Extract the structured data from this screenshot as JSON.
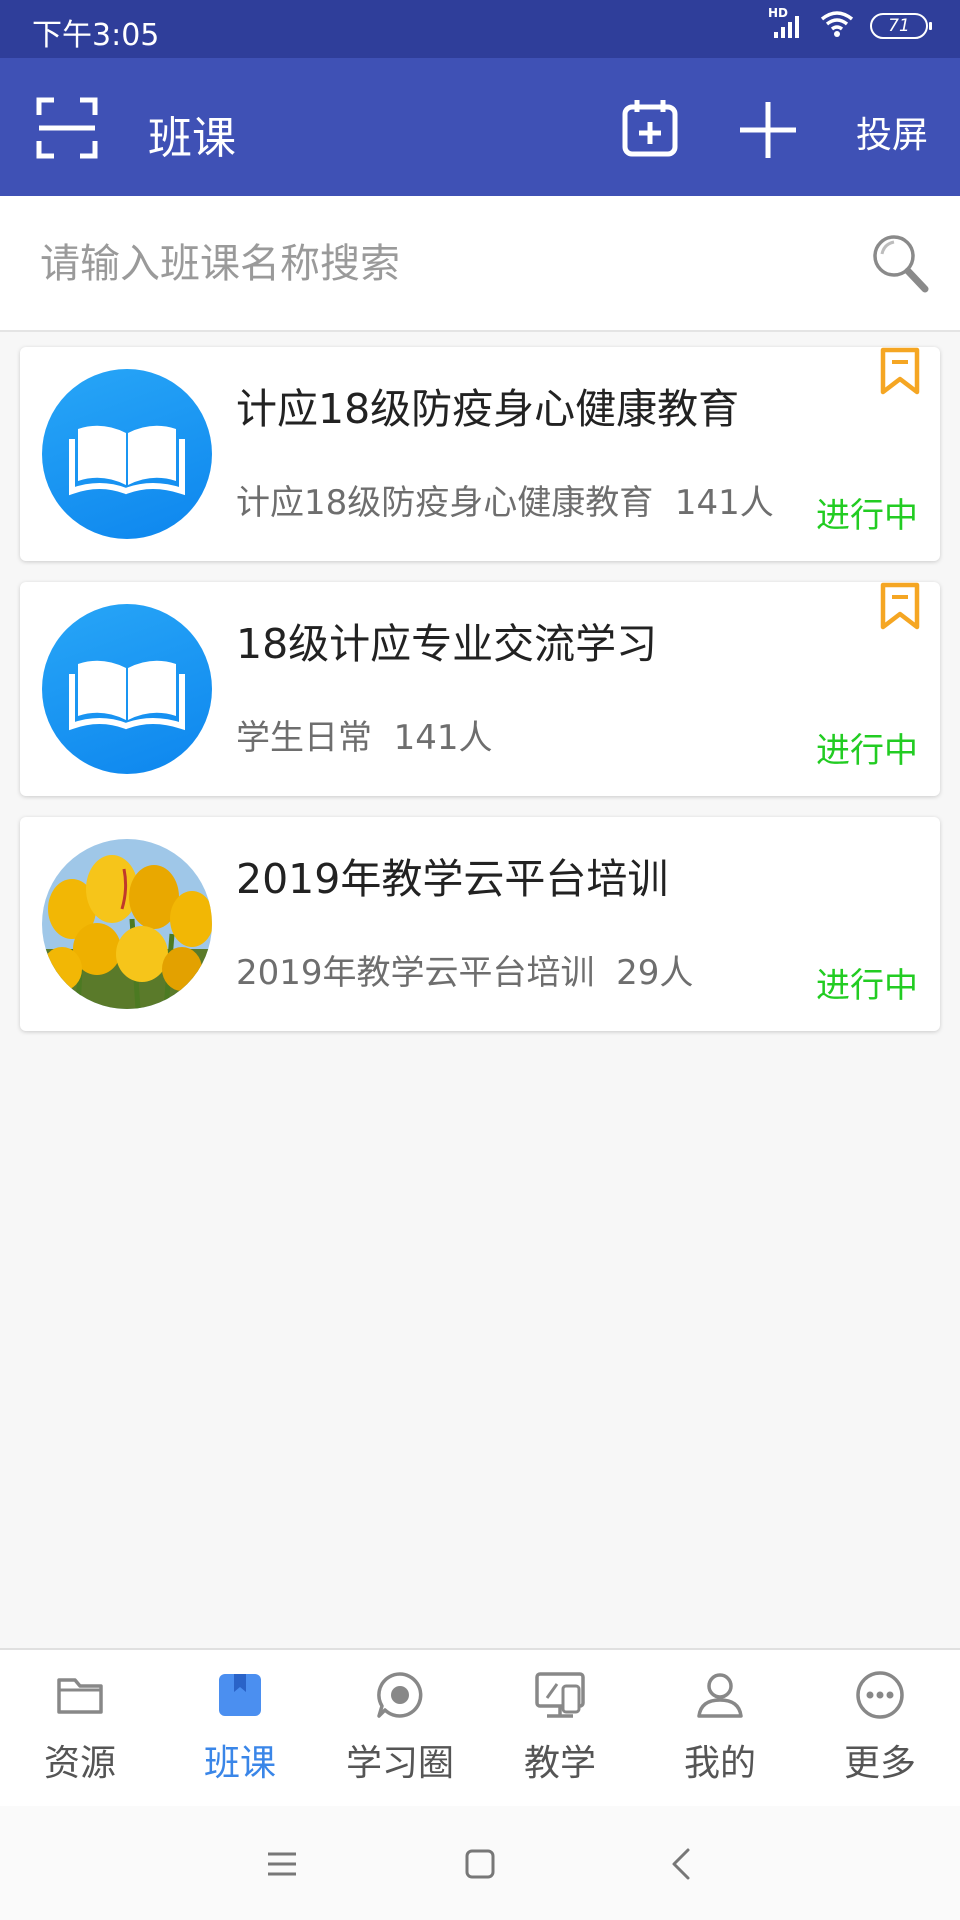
{
  "status_bar": {
    "time": "下午3:05",
    "network": "HD",
    "battery": "71"
  },
  "app_bar": {
    "title": "班课",
    "cast_label": "投屏",
    "icons": [
      "scan-icon",
      "calendar-add-icon",
      "plus-icon"
    ]
  },
  "search": {
    "placeholder": "请输入班课名称搜索",
    "value": ""
  },
  "courses": [
    {
      "title": "计应18级防疫身心健康教育",
      "subtitle": "计应18级防疫身心健康教育",
      "members": "141人",
      "status": "进行中",
      "avatar": "book-icon",
      "bookmarked": true
    },
    {
      "title": "18级计应专业交流学习",
      "subtitle": "学生日常",
      "members": "141人",
      "status": "进行中",
      "avatar": "book-icon",
      "bookmarked": true
    },
    {
      "title": "2019年教学云平台培训",
      "subtitle": "2019年教学云平台培训",
      "members": "29人",
      "status": "进行中",
      "avatar": "tulip-photo",
      "bookmarked": false
    }
  ],
  "bottom_nav": [
    {
      "label": "资源",
      "icon": "folder-icon",
      "active": false
    },
    {
      "label": "班课",
      "icon": "bookmark-icon",
      "active": true
    },
    {
      "label": "学习圈",
      "icon": "chat-icon",
      "active": false
    },
    {
      "label": "教学",
      "icon": "teaching-icon",
      "active": false
    },
    {
      "label": "我的",
      "icon": "user-icon",
      "active": false
    },
    {
      "label": "更多",
      "icon": "more-icon",
      "active": false
    }
  ],
  "colors": {
    "primary": "#3f51b5",
    "status_bar": "#2f3e9a",
    "active_tab": "#3a86e8",
    "status_green": "#22cc22",
    "bookmark": "#f5a623"
  }
}
